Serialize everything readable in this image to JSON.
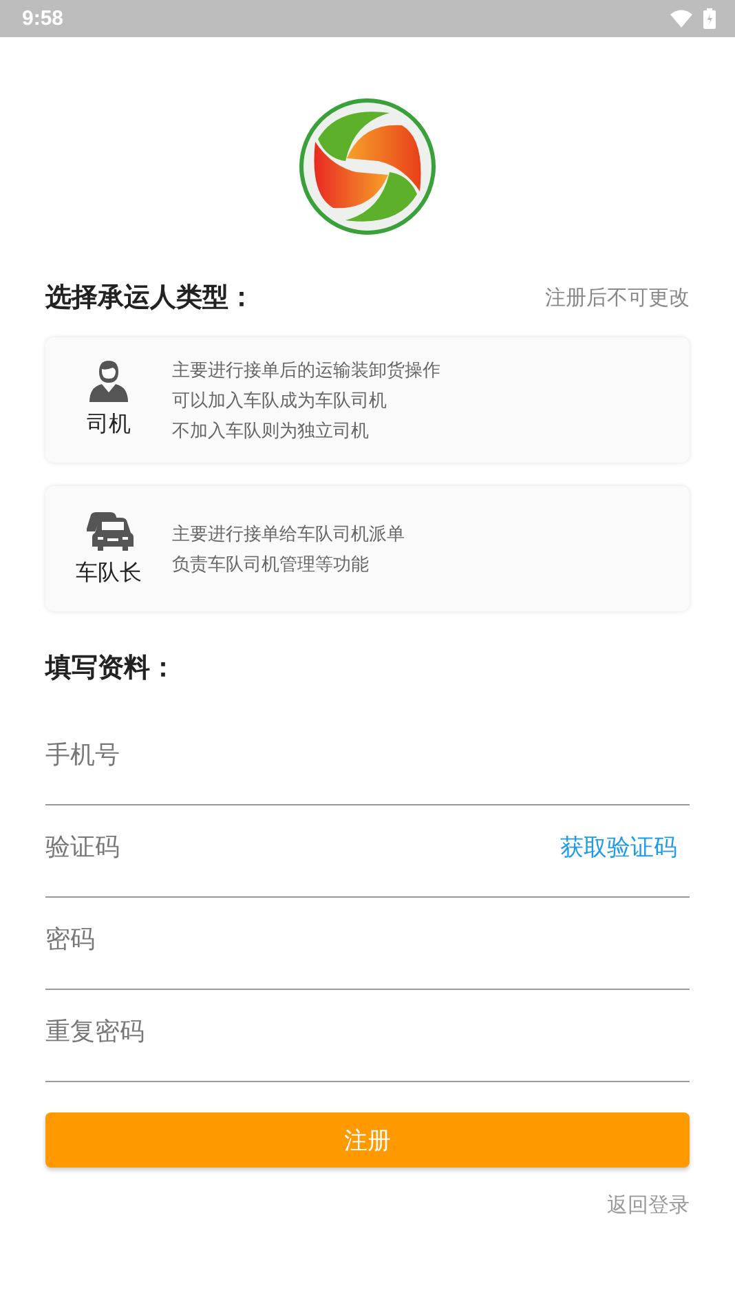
{
  "status_bar": {
    "time": "9:58"
  },
  "carrier_section": {
    "title": "选择承运人类型：",
    "note": "注册后不可更改"
  },
  "carrier_types": [
    {
      "kind": "driver",
      "label": "司机",
      "lines": [
        "主要进行接单后的运输装卸货操作",
        "可以加入车队成为车队司机",
        "不加入车队则为独立司机"
      ],
      "selected": false
    },
    {
      "kind": "fleet",
      "label": "车队长",
      "lines": [
        "主要进行接单给车队司机派单",
        "负责车队司机管理等功能"
      ],
      "selected": false
    }
  ],
  "form_section": {
    "title": "填写资料："
  },
  "fields": [
    {
      "placeholder": "手机号"
    },
    {
      "placeholder": "验证码",
      "action": "获取验证码"
    },
    {
      "placeholder": "密码"
    },
    {
      "placeholder": "重复密码"
    }
  ],
  "submit": "注册",
  "back_link": "返回登录"
}
